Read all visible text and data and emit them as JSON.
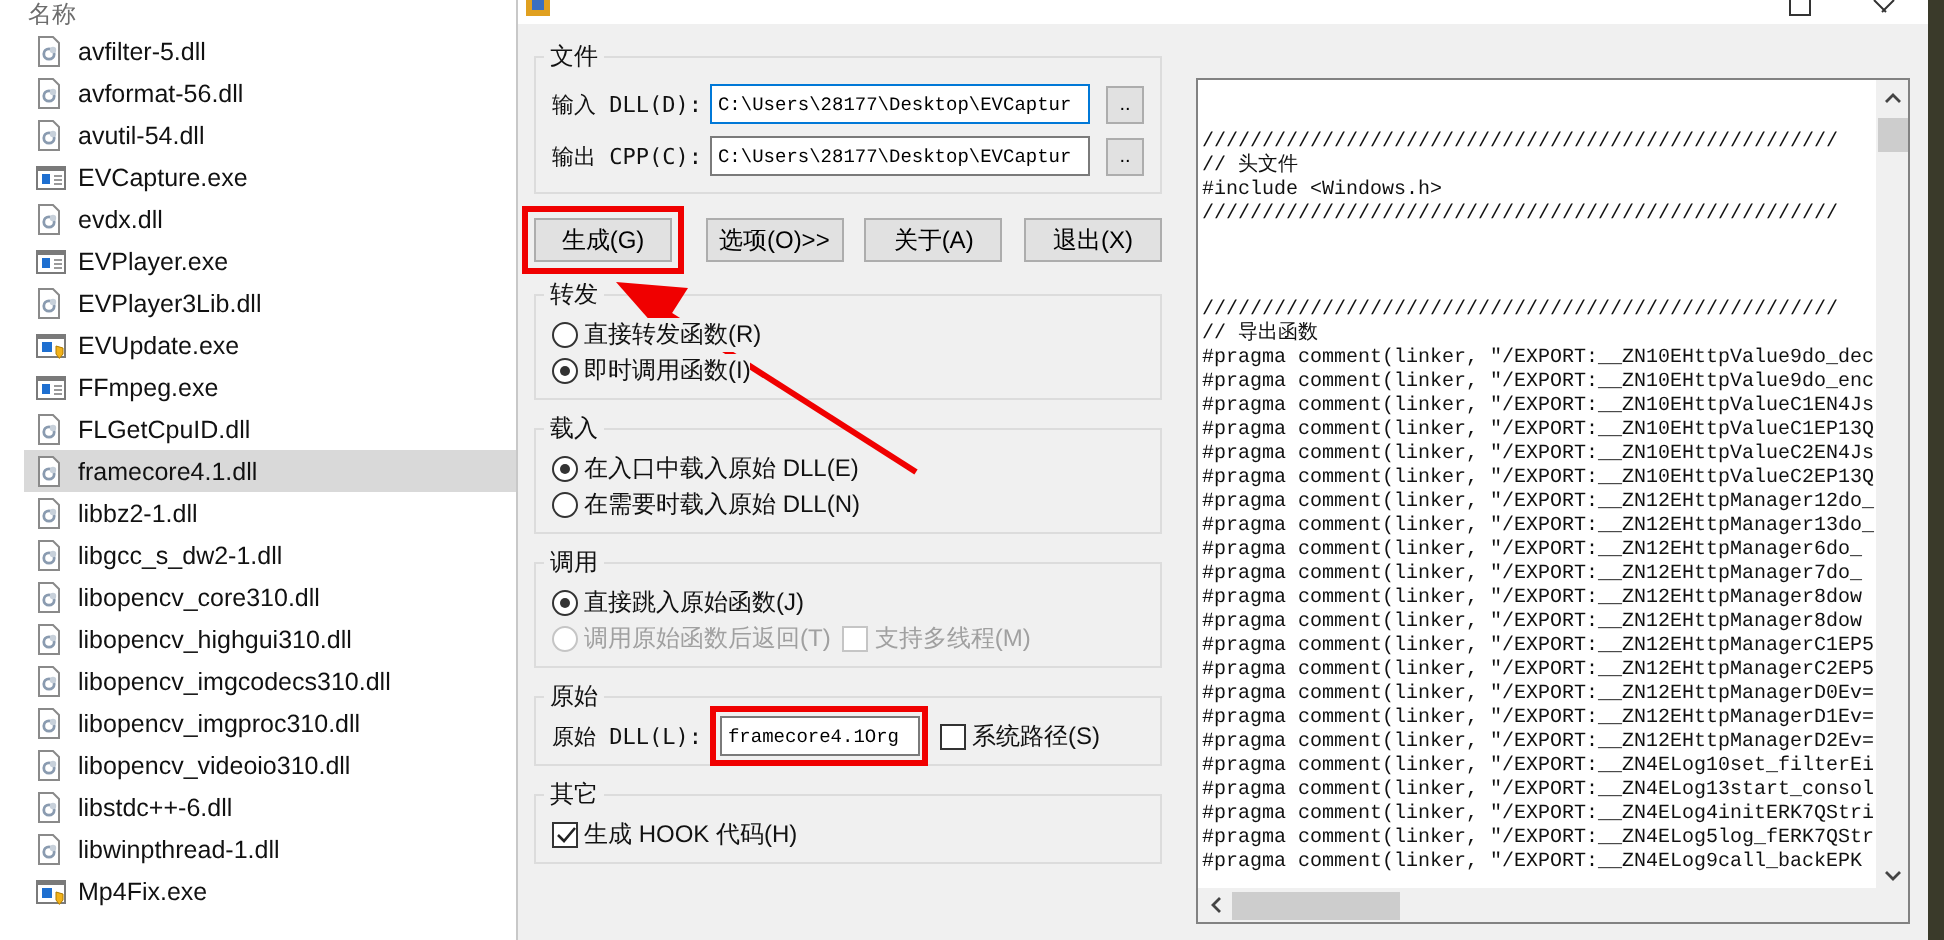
{
  "explorer": {
    "column_header": "名称",
    "files": [
      {
        "name": "avfilter-5.dll",
        "kind": "dll",
        "selected": false
      },
      {
        "name": "avformat-56.dll",
        "kind": "dll",
        "selected": false
      },
      {
        "name": "avutil-54.dll",
        "kind": "dll",
        "selected": false
      },
      {
        "name": "EVCapture.exe",
        "kind": "exe",
        "selected": false
      },
      {
        "name": "evdx.dll",
        "kind": "dll",
        "selected": false
      },
      {
        "name": "EVPlayer.exe",
        "kind": "exe",
        "selected": false
      },
      {
        "name": "EVPlayer3Lib.dll",
        "kind": "dll",
        "selected": false
      },
      {
        "name": "EVUpdate.exe",
        "kind": "installer",
        "selected": false
      },
      {
        "name": "FFmpeg.exe",
        "kind": "exe",
        "selected": false
      },
      {
        "name": "FLGetCpuID.dll",
        "kind": "dll",
        "selected": false
      },
      {
        "name": "framecore4.1.dll",
        "kind": "dll",
        "selected": true
      },
      {
        "name": "libbz2-1.dll",
        "kind": "dll",
        "selected": false
      },
      {
        "name": "libgcc_s_dw2-1.dll",
        "kind": "dll",
        "selected": false
      },
      {
        "name": "libopencv_core310.dll",
        "kind": "dll",
        "selected": false
      },
      {
        "name": "libopencv_highgui310.dll",
        "kind": "dll",
        "selected": false
      },
      {
        "name": "libopencv_imgcodecs310.dll",
        "kind": "dll",
        "selected": false
      },
      {
        "name": "libopencv_imgproc310.dll",
        "kind": "dll",
        "selected": false
      },
      {
        "name": "libopencv_videoio310.dll",
        "kind": "dll",
        "selected": false
      },
      {
        "name": "libstdc++-6.dll",
        "kind": "dll",
        "selected": false
      },
      {
        "name": "libwinpthread-1.dll",
        "kind": "dll",
        "selected": false
      },
      {
        "name": "Mp4Fix.exe",
        "kind": "installer",
        "selected": false
      }
    ]
  },
  "dialog": {
    "file_group": {
      "title": "文件",
      "rows": [
        {
          "label": "输入 DLL(D):",
          "value": "C:\\Users\\28177\\Desktop\\EVCaptur",
          "focused": true,
          "browse": ".."
        },
        {
          "label": "输出 CPP(C):",
          "value": "C:\\Users\\28177\\Desktop\\EVCaptur",
          "focused": false,
          "browse": ".."
        }
      ]
    },
    "buttons": [
      {
        "label": "生成(G)",
        "highlighted": true
      },
      {
        "label": "选项(O)>>",
        "highlighted": false
      },
      {
        "label": "关于(A)",
        "highlighted": false
      },
      {
        "label": "退出(X)",
        "highlighted": false
      }
    ],
    "groups": [
      {
        "title": "转发",
        "rows": [
          [
            {
              "kind": "radio",
              "label": "直接转发函数(R)",
              "checked": false,
              "disabled": false
            }
          ],
          [
            {
              "kind": "radio",
              "label": "即时调用函数(I)",
              "checked": true,
              "disabled": false
            }
          ]
        ]
      },
      {
        "title": "载入",
        "rows": [
          [
            {
              "kind": "radio",
              "label": "在入口中载入原始 DLL(E)",
              "checked": true,
              "disabled": false
            }
          ],
          [
            {
              "kind": "radio",
              "label": "在需要时载入原始 DLL(N)",
              "checked": false,
              "disabled": false
            }
          ]
        ]
      },
      {
        "title": "调用",
        "rows": [
          [
            {
              "kind": "radio",
              "label": "直接跳入原始函数(J)",
              "checked": true,
              "disabled": false
            }
          ],
          [
            {
              "kind": "radio",
              "label": "调用原始函数后返回(T)",
              "checked": false,
              "disabled": true
            },
            {
              "kind": "checkbox",
              "label": "支持多线程(M)",
              "checked": false,
              "disabled": true
            }
          ]
        ]
      },
      {
        "title": "原始",
        "rows": [
          [
            {
              "kind": "field",
              "label": "原始 DLL(L):",
              "value": "framecore4.1Org",
              "highlighted": true
            },
            {
              "kind": "checkbox",
              "label": "系统路径(S)",
              "checked": false,
              "disabled": false
            }
          ]
        ]
      },
      {
        "title": "其它",
        "rows": [
          [
            {
              "kind": "checkbox",
              "label": "生成 HOOK 代码(H)",
              "checked": true,
              "disabled": false
            }
          ]
        ]
      }
    ],
    "code_view": {
      "blocks": [
        {
          "lines": [
            "/////////////////////////////////////////////////////",
            "// 头文件",
            "#include <Windows.h>",
            "/////////////////////////////////////////////////////"
          ]
        },
        {
          "lines": [
            "/////////////////////////////////////////////////////",
            "// 导出函数",
            "#pragma comment(linker, \"/EXPORT:__ZN10EHttpValue9do_dec",
            "#pragma comment(linker, \"/EXPORT:__ZN10EHttpValue9do_enc",
            "#pragma comment(linker, \"/EXPORT:__ZN10EHttpValueC1EN4Js",
            "#pragma comment(linker, \"/EXPORT:__ZN10EHttpValueC1EP13Q",
            "#pragma comment(linker, \"/EXPORT:__ZN10EHttpValueC2EN4Js",
            "#pragma comment(linker, \"/EXPORT:__ZN10EHttpValueC2EP13Q",
            "#pragma comment(linker, \"/EXPORT:__ZN12EHttpManager12do_",
            "#pragma comment(linker, \"/EXPORT:__ZN12EHttpManager13do_",
            "#pragma comment(linker, \"/EXPORT:__ZN12EHttpManager6do_",
            "#pragma comment(linker, \"/EXPORT:__ZN12EHttpManager7do_",
            "#pragma comment(linker, \"/EXPORT:__ZN12EHttpManager8dow",
            "#pragma comment(linker, \"/EXPORT:__ZN12EHttpManager8dow",
            "#pragma comment(linker, \"/EXPORT:__ZN12EHttpManagerC1EP5",
            "#pragma comment(linker, \"/EXPORT:__ZN12EHttpManagerC2EP5",
            "#pragma comment(linker, \"/EXPORT:__ZN12EHttpManagerD0Ev=",
            "#pragma comment(linker, \"/EXPORT:__ZN12EHttpManagerD1Ev=",
            "#pragma comment(linker, \"/EXPORT:__ZN12EHttpManagerD2Ev=",
            "#pragma comment(linker, \"/EXPORT:__ZN4ELog10set_filterEi",
            "#pragma comment(linker, \"/EXPORT:__ZN4ELog13start_consol",
            "#pragma comment(linker, \"/EXPORT:__ZN4ELog4initERK7QStri",
            "#pragma comment(linker, \"/EXPORT:__ZN4ELog5log_fERK7QStr",
            "#pragma comment(linker, \"/EXPORT:__ZN4ELog9call_backEPK"
          ]
        }
      ]
    }
  },
  "annotation": {
    "kind": "arrow"
  }
}
